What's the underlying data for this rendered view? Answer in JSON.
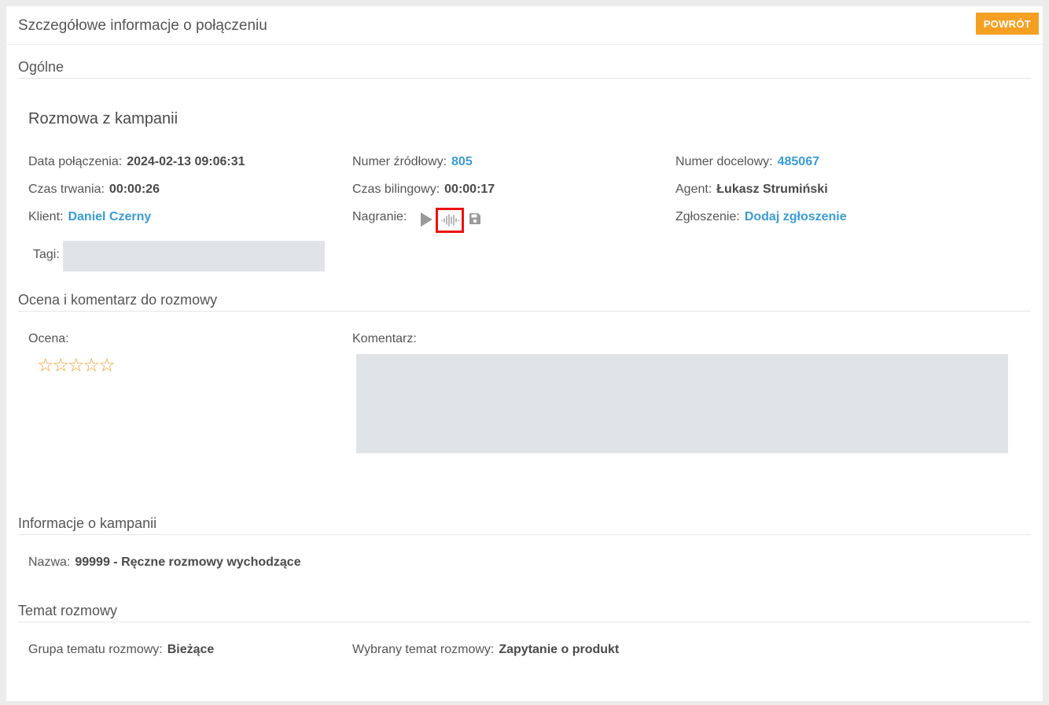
{
  "header": {
    "title": "Szczegółowe informacje o połączeniu",
    "back_label": "POWRÓT"
  },
  "general": {
    "section_title": "Ogólne",
    "subtitle": "Rozmowa z kampanii",
    "call_date": {
      "label": "Data połączenia:",
      "value": "2024-02-13 09:06:31"
    },
    "source_number": {
      "label": "Numer źródłowy:",
      "value": "805"
    },
    "target_number": {
      "label": "Numer docelowy:",
      "value": "485067"
    },
    "duration": {
      "label": "Czas trwania:",
      "value": "00:00:26"
    },
    "billing_time": {
      "label": "Czas bilingowy:",
      "value": "00:00:17"
    },
    "agent": {
      "label": "Agent:",
      "value": "Łukasz Strumiński"
    },
    "client": {
      "label": "Klient:",
      "value": "Daniel Czerny"
    },
    "recording": {
      "label": "Nagranie:",
      "icons": [
        "play-icon",
        "waveform-icon",
        "save-icon"
      ]
    },
    "ticket": {
      "label": "Zgłoszenie:",
      "value": "Dodaj zgłoszenie"
    },
    "tags": {
      "label": "Tagi:",
      "value": ""
    }
  },
  "rating": {
    "section_title": "Ocena i komentarz do rozmowy",
    "rating_label": "Ocena:",
    "stars": {
      "value": 0,
      "max": 5,
      "glyph": "☆"
    },
    "comment_label": "Komentarz:",
    "comment_value": ""
  },
  "campaign": {
    "section_title": "Informacje o kampanii",
    "name": {
      "label": "Nazwa:",
      "value": "99999 - Ręczne rozmowy wychodzące"
    }
  },
  "topic": {
    "section_title": "Temat rozmowy",
    "group": {
      "label": "Grupa tematu rozmowy:",
      "value": "Bieżące"
    },
    "selected": {
      "label": "Wybrany temat rozmowy:",
      "value": "Zapytanie o produkt"
    }
  },
  "colors": {
    "accent": "#f5a023",
    "link": "#3a9bd9",
    "highlight": "#ee1111",
    "star": "#f0a030"
  }
}
